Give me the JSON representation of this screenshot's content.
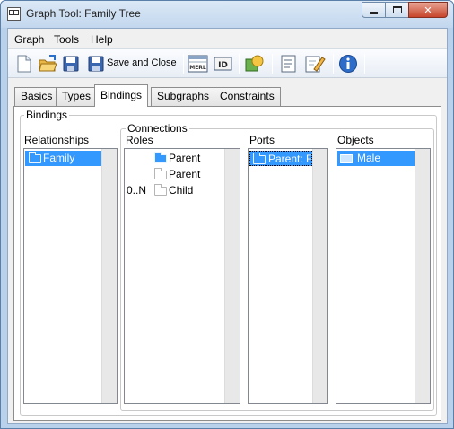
{
  "window": {
    "title": "Graph Tool: Family Tree"
  },
  "menu": [
    "Graph",
    "Tools",
    "Help"
  ],
  "toolbar": {
    "save_close_label": "Save and Close",
    "merl_label": "MERL",
    "id_label": "ID"
  },
  "tabs": [
    "Basics",
    "Types",
    "Bindings",
    "Subgraphs",
    "Constraints"
  ],
  "active_tab": "Bindings",
  "bindings": {
    "group_label": "Bindings",
    "relationships_label": "Relationships",
    "relationships": [
      "Family"
    ],
    "connections_label": "Connections",
    "roles_label": "Roles",
    "roles": [
      {
        "cardinality": "",
        "name": "Parent",
        "selected": true
      },
      {
        "cardinality": "",
        "name": "Parent",
        "selected": false
      },
      {
        "cardinality": "0..N",
        "name": "Child",
        "selected": false
      }
    ],
    "ports_label": "Ports",
    "ports": [
      "Parent: F"
    ],
    "objects_label": "Objects",
    "objects": [
      "Male"
    ]
  }
}
